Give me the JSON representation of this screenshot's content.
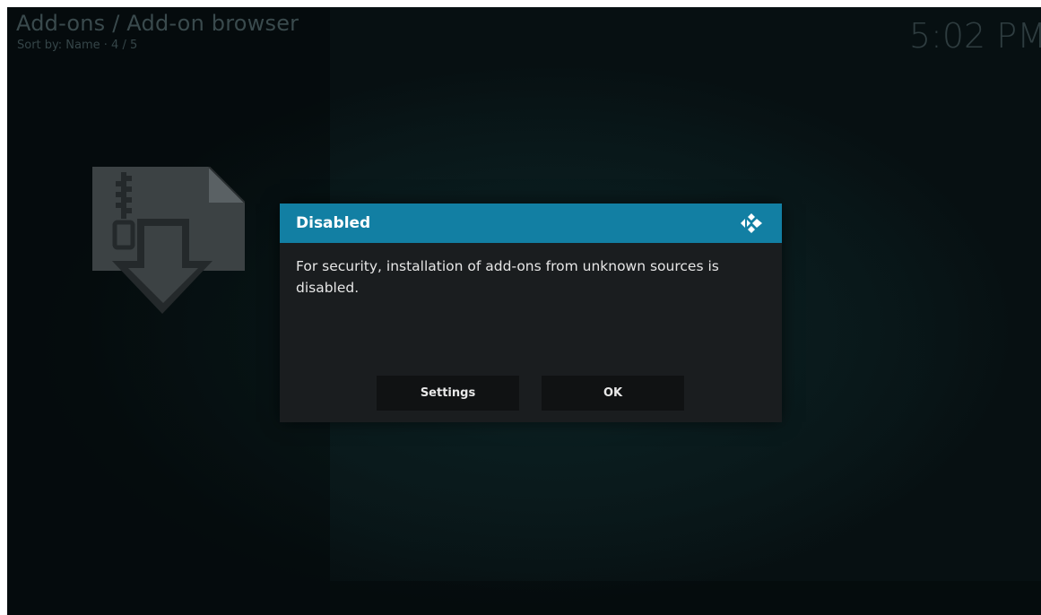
{
  "header": {
    "title": "Add-ons / Add-on browser",
    "subtitle": "Sort by: Name · 4 / 5",
    "clock": "5:02 PM"
  },
  "background": {
    "addon_icon": "zip-download-icon"
  },
  "dialog": {
    "title": "Disabled",
    "logo_icon": "kodi-logo-icon",
    "message": "For security, installation of add-ons from unknown sources is disabled.",
    "buttons": {
      "settings_label": "Settings",
      "ok_label": "OK"
    }
  },
  "colors": {
    "dialog_header": "#127fa3",
    "dialog_body": "#1a1d1f",
    "button": "#101213"
  }
}
